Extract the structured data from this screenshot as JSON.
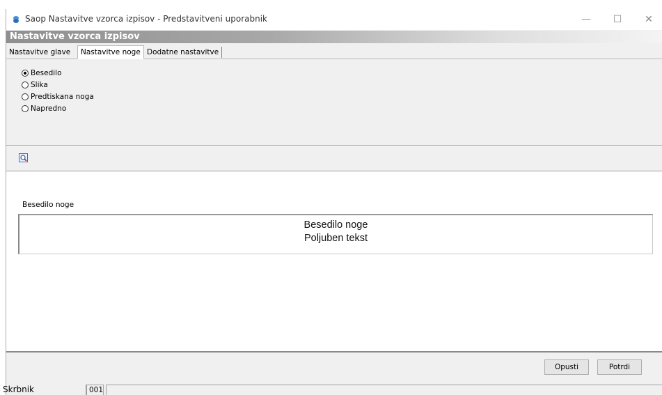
{
  "window": {
    "title": "Saop Nastavitve vzorca izpisov - Predstavitveni uporabnik",
    "minimize": "—",
    "maximize": "☐",
    "close": "✕"
  },
  "banner": {
    "title": "Nastavitve vzorca izpisov"
  },
  "tabs": [
    {
      "label": "Nastavitve glave",
      "active": false
    },
    {
      "label": "Nastavitve noge",
      "active": true
    },
    {
      "label": "Dodatne nastavitve",
      "active": false
    }
  ],
  "footer_type": {
    "selected": "Besedilo",
    "options": [
      "Besedilo",
      "Slika",
      "Predtiskana noga",
      "Napredno"
    ]
  },
  "toolbar": {
    "preview_icon": "preview-icon"
  },
  "footer_text": {
    "label": "Besedilo noge",
    "lines": [
      "Besedilo noge",
      "Poljuben tekst"
    ]
  },
  "buttons": {
    "cancel": "Opusti",
    "ok": "Potrdi"
  },
  "status": {
    "user": "Skrbnik",
    "code": "001",
    "extra": ""
  }
}
